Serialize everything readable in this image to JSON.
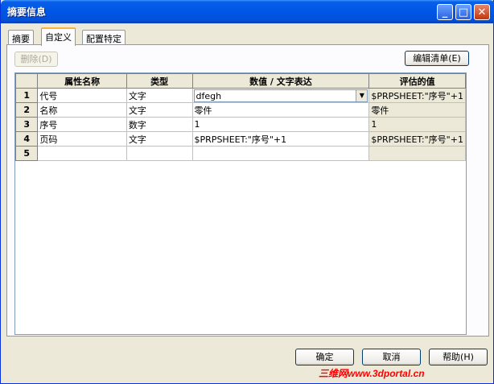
{
  "window": {
    "title": "摘要信息"
  },
  "title_buttons": {
    "minimize": "_",
    "maximize": "□",
    "close": "✕"
  },
  "tabs": [
    {
      "label": "摘要"
    },
    {
      "label": "自定义"
    },
    {
      "label": "配置特定"
    }
  ],
  "toolbar": {
    "delete_label": "删除(D)",
    "edit_list_label": "编辑清单(E)"
  },
  "grid": {
    "headers": [
      "属性名称",
      "类型",
      "数值 / 文字表达",
      "评估的值"
    ],
    "rows": [
      {
        "num": "1",
        "name": "代号",
        "type": "文字",
        "value": "dfegh",
        "eval": "$PRPSHEET:\"序号\"+1"
      },
      {
        "num": "2",
        "name": "名称",
        "type": "文字",
        "value": "零件",
        "eval": "零件"
      },
      {
        "num": "3",
        "name": "序号",
        "type": "数字",
        "value": "1",
        "eval": "1"
      },
      {
        "num": "4",
        "name": "页码",
        "type": "文字",
        "value": "$PRPSHEET:\"序号\"+1",
        "eval": "$PRPSHEET:\"序号\"+1"
      },
      {
        "num": "5",
        "name": "",
        "type": "",
        "value": "",
        "eval": ""
      }
    ]
  },
  "buttons": {
    "ok": "确定",
    "cancel": "取消",
    "help": "帮助(H)"
  },
  "watermark": "三维网www.3dportal.cn"
}
